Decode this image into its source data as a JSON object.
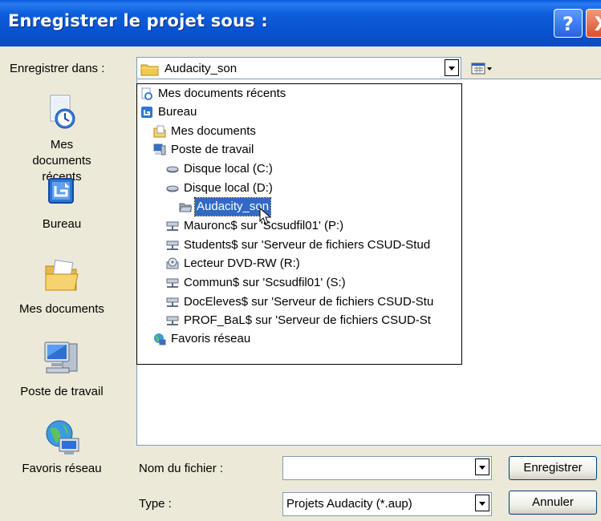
{
  "window": {
    "title": "Enregistrer le projet sous :",
    "help_glyph": "?",
    "close_glyph": "X"
  },
  "save_in": {
    "label": "Enregistrer dans :",
    "value": "Audacity_son"
  },
  "places": [
    {
      "label": "Mes documents récents",
      "icon": "recent-documents-icon"
    },
    {
      "label": "Bureau",
      "icon": "desktop-icon"
    },
    {
      "label": "Mes documents",
      "icon": "my-documents-icon"
    },
    {
      "label": "Poste de travail",
      "icon": "my-computer-icon"
    },
    {
      "label": "Favoris réseau",
      "icon": "network-places-icon"
    }
  ],
  "dropdown_items": [
    {
      "label": "Mes documents récents",
      "icon": "recent-documents-icon",
      "level": 0
    },
    {
      "label": "Bureau",
      "icon": "desktop-icon",
      "level": 0
    },
    {
      "label": "Mes documents",
      "icon": "my-documents-icon",
      "level": 1
    },
    {
      "label": "Poste de travail",
      "icon": "my-computer-icon",
      "level": 1
    },
    {
      "label": "Disque local (C:)",
      "icon": "hard-drive-icon",
      "level": 2
    },
    {
      "label": "Disque local (D:)",
      "icon": "hard-drive-icon",
      "level": 2
    },
    {
      "label": "Audacity_son",
      "icon": "folder-open-icon",
      "level": 3,
      "selected": true
    },
    {
      "label": "Mauronc$ sur 'Scsudfil01' (P:)",
      "icon": "network-drive-icon",
      "level": 2
    },
    {
      "label": "Students$ sur 'Serveur de fichiers CSUD-Stud",
      "icon": "network-drive-icon",
      "level": 2
    },
    {
      "label": "Lecteur DVD-RW (R:)",
      "icon": "dvd-drive-icon",
      "level": 2
    },
    {
      "label": "Commun$ sur 'Scsudfil01' (S:)",
      "icon": "network-drive-icon",
      "level": 2
    },
    {
      "label": "DocEleves$ sur 'Serveur de fichiers CSUD-Stu",
      "icon": "network-drive-icon",
      "level": 2
    },
    {
      "label": "PROF_BaL$ sur 'Serveur de fichiers CSUD-St",
      "icon": "network-drive-icon",
      "level": 2
    },
    {
      "label": "Favoris réseau",
      "icon": "network-places-icon",
      "level": 1
    }
  ],
  "filename": {
    "label": "Nom du fichier :",
    "value": ""
  },
  "type": {
    "label": "Type :",
    "value": "Projets Audacity (*.aup)"
  },
  "buttons": {
    "save": "Enregistrer",
    "cancel": "Annuler"
  },
  "colors": {
    "titlebar": "#0852CE",
    "selection": "#316AC5",
    "dialog_bg": "#ECE9D8"
  }
}
